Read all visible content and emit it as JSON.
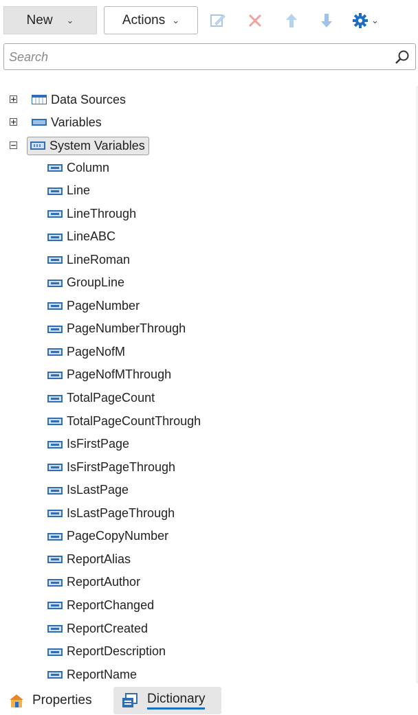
{
  "toolbar": {
    "new_label": "New",
    "actions_label": "Actions",
    "icons": [
      "edit-icon",
      "delete-icon",
      "move-up-icon",
      "move-down-icon",
      "settings-icon"
    ],
    "accent": "#1b6ec2",
    "delete_color": "#f06a6a"
  },
  "search": {
    "placeholder": "Search",
    "value": ""
  },
  "tree": {
    "data_sources": "Data Sources",
    "variables": "Variables",
    "system_variables": "System Variables",
    "items": [
      "Column",
      "Line",
      "LineThrough",
      "LineABC",
      "LineRoman",
      "GroupLine",
      "PageNumber",
      "PageNumberThrough",
      "PageNofM",
      "PageNofMThrough",
      "TotalPageCount",
      "TotalPageCountThrough",
      "IsFirstPage",
      "IsFirstPageThrough",
      "IsLastPage",
      "IsLastPageThrough",
      "PageCopyNumber",
      "ReportAlias",
      "ReportAuthor",
      "ReportChanged",
      "ReportCreated",
      "ReportDescription",
      "ReportName"
    ]
  },
  "tabs": {
    "properties": "Properties",
    "dictionary": "Dictionary",
    "active": "Dictionary"
  }
}
